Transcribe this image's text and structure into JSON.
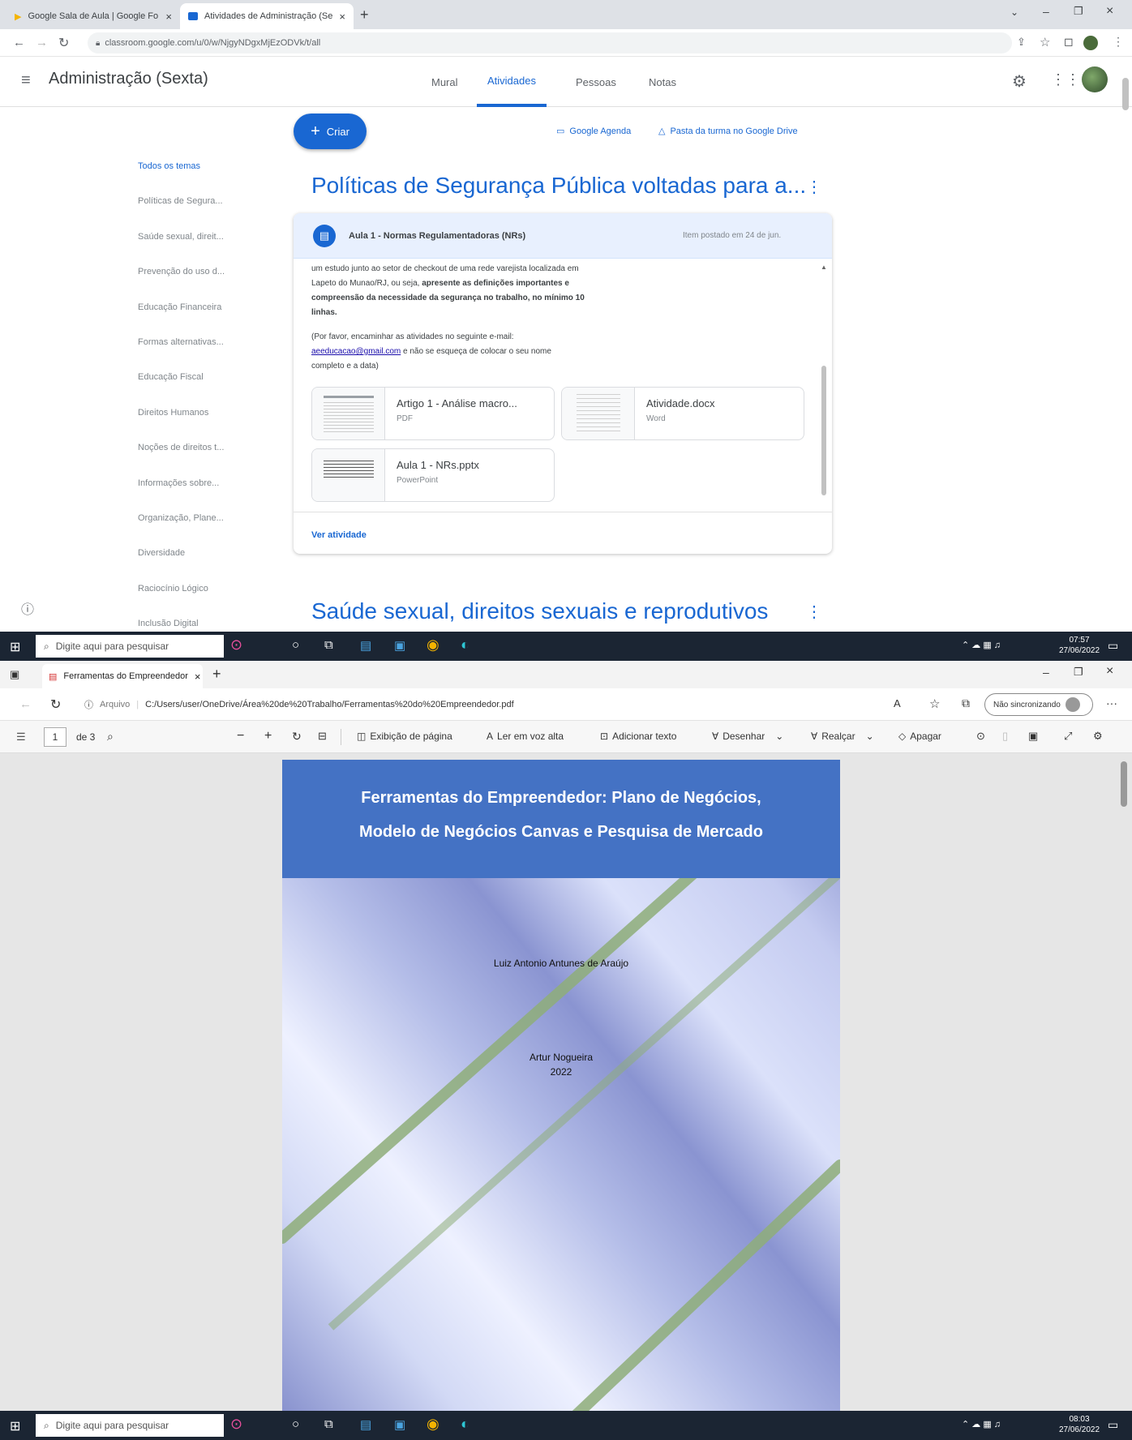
{
  "classroom": {
    "tabs": [
      {
        "label": "Google Sala de Aula | Google Fo"
      },
      {
        "label": "Atividades de Administração (Se"
      }
    ],
    "url": "classroom.google.com/u/0/w/NjgyNDgxMjEzODVk/t/all",
    "class_title": "Administração (Sexta)",
    "nav_tabs": [
      "Mural",
      "Atividades",
      "Pessoas",
      "Notas"
    ],
    "create_label": "Criar",
    "calendar_link": "Google Agenda",
    "drive_link": "Pasta da turma no Google Drive",
    "topics": [
      "Todos os temas",
      "Políticas de Segura...",
      "Saúde sexual, direit...",
      "Prevenção do uso d...",
      "Educação Financeira",
      "Formas alternativas...",
      "Educação Fiscal",
      "Direitos Humanos",
      "Noções de direitos t...",
      "Informações sobre...",
      "Organização, Plane...",
      "Diversidade",
      "Raciocínio Lógico",
      "Inclusão Digital"
    ],
    "section1_title": "Políticas de Segurança Pública voltadas para a...",
    "assignment": {
      "title": "Aula 1 - Normas Regulamentadoras (NRs)",
      "meta": "Item postado em 24 de jun.",
      "line1": "um estudo junto ao setor de checkout de uma rede varejista localizada em",
      "line2a": "Lapeto do Munao/RJ, ou seja,",
      "line2b": "apresente as definições importantes e",
      "line3": "compreensão da necessidade da segurança no trabalho, no mínimo 10",
      "line4": "linhas.",
      "line5": "(Por favor, encaminhar as atividades no seguinte e-mail:",
      "email": "aeeducacao@gmail.com",
      "line6a": " e não se esqueça de colocar o seu nome",
      "line6b": "completo e a data)",
      "attachments": [
        {
          "name": "Artigo 1 - Análise macro...",
          "type": "PDF"
        },
        {
          "name": "Atividade.docx",
          "type": "Word"
        },
        {
          "name": "Aula 1 - NRs.pptx",
          "type": "PowerPoint"
        }
      ],
      "view_link": "Ver atividade"
    },
    "section2_title": "Saúde sexual, direitos sexuais e reprodutivos",
    "taskbar": {
      "search": "Digite aqui para pesquisar",
      "time": "07:57",
      "date": "27/06/2022"
    }
  },
  "edge": {
    "tab_label": "Ferramentas do Empreendedor",
    "url_prefix": "Arquivo",
    "url": "C:/Users/user/OneDrive/Área%20de%20Trabalho/Ferramentas%20do%20Empreendedor.pdf",
    "sync_label": "Não sincronizando",
    "page_num": "1",
    "page_total": "de 3",
    "toolbar": {
      "page_view": "Exibição de página",
      "read_aloud": "Ler em voz alta",
      "add_text": "Adicionar texto",
      "draw": "Desenhar",
      "highlight": "Realçar",
      "erase": "Apagar"
    },
    "pdf": {
      "title_line1": "Ferramentas do Empreendedor: Plano de Negócios,",
      "title_line2": "Modelo de Negócios Canvas e Pesquisa de Mercado",
      "author": "Luiz Antonio Antunes de Araújo",
      "advisor": "Artur Nogueira",
      "year": "2022"
    },
    "taskbar": {
      "search": "Digite aqui para pesquisar",
      "time": "08:03",
      "date": "27/06/2022"
    }
  },
  "colors": {
    "accent": "#1967d2",
    "pdf_header": "#4472c4",
    "taskbar": "#1b2533"
  }
}
